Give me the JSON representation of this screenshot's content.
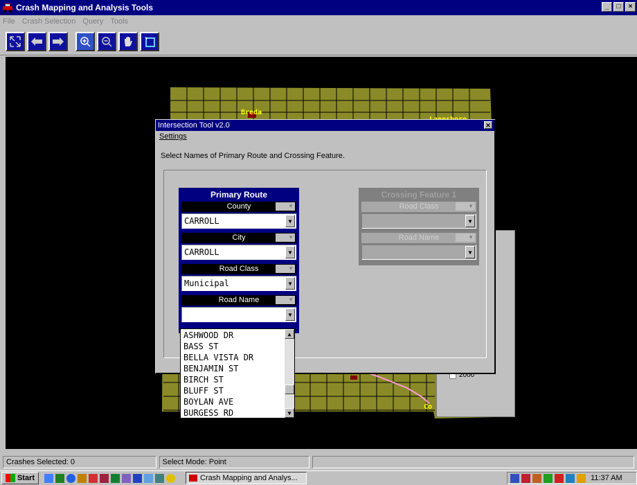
{
  "window": {
    "title": "Crash Mapping and Analysis Tools",
    "controls": [
      "_",
      "□",
      "×"
    ]
  },
  "menu": {
    "file": "File",
    "crash_selection": "Crash Selection",
    "query": "Query",
    "tools": "Tools"
  },
  "toolbar": {
    "icons": [
      "zoom-extent-icon",
      "back-icon",
      "forward-icon",
      "zoom-in-icon",
      "zoom-out-icon",
      "pan-hand-icon",
      "select-icon"
    ]
  },
  "map": {
    "towns": [
      "Breda",
      "Lanesboro",
      "Co"
    ],
    "colors": {
      "land": "#8a8a28",
      "grid": "#000000",
      "road": "#ff9ad8",
      "label": "#ffff00"
    }
  },
  "dialog": {
    "title": "Intersection Tool v2.0",
    "menu_settings": "Settings",
    "instruction": "Select Names of Primary Route and Crossing Feature.",
    "primary": {
      "title": "Primary Route",
      "county_label": "County",
      "county_value": "CARROLL",
      "city_label": "City",
      "city_value": "CARROLL",
      "roadclass_label": "Road Class",
      "roadclass_value": "Municipal",
      "roadname_label": "Road Name",
      "roadname_value": ""
    },
    "crossing": {
      "title": "Crossing Feature 1",
      "roadclass_label": "Road Class",
      "roadname_label": "Road Name"
    },
    "dropdown_items": [
      "ASHWOOD DR",
      "BASS ST",
      "BELLA VISTA DR",
      "BENJAMIN ST",
      "BIRCH ST",
      "BLUFF ST",
      "BOYLAN AVE",
      "BURGESS RD"
    ]
  },
  "bgwin": {
    "year": "2000"
  },
  "status": {
    "crashes": "Crashes Selected: 0",
    "mode": "Select Mode: Point"
  },
  "taskbar": {
    "start": "Start",
    "task": "Crash Mapping and Analys...",
    "clock": "11:37 AM"
  }
}
